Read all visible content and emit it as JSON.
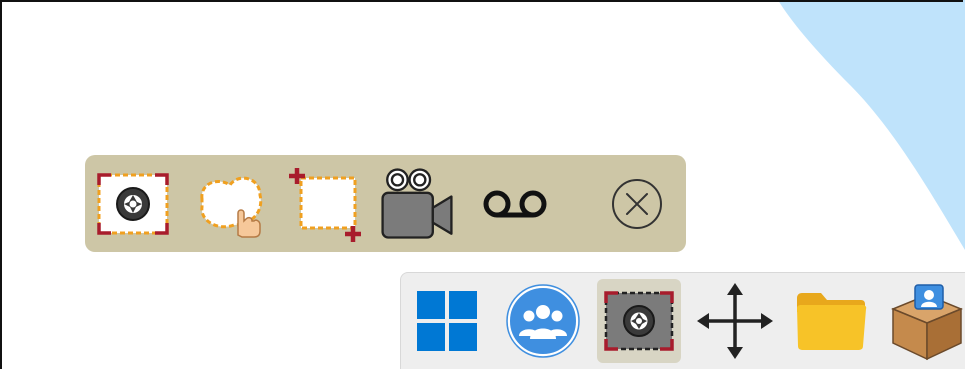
{
  "window": {
    "title": ""
  },
  "colors": {
    "background": "#ffffff",
    "background_shape": "#bfe3fb",
    "toolbar_bg": "#cdc6a6",
    "dashed_orange": "#f0a020",
    "crop_red": "#a81c2c",
    "taskbar_bg": "#eeeeee",
    "windows_blue": "#0078d4",
    "people_blue": "#3f8fe0",
    "folder_yellow": "#f7c328"
  },
  "capture_toolbar": {
    "buttons": [
      {
        "id": "fullscreen-capture",
        "icon": "camera-aperture-icon",
        "label": ""
      },
      {
        "id": "freeform-capture",
        "icon": "freeform-hand-icon",
        "label": ""
      },
      {
        "id": "region-capture",
        "icon": "crop-region-icon",
        "label": ""
      },
      {
        "id": "video-record",
        "icon": "video-camera-icon",
        "label": ""
      },
      {
        "id": "audio-record",
        "icon": "voicemail-icon",
        "label": ""
      },
      {
        "id": "close",
        "icon": "close-circle-icon",
        "label": ""
      }
    ]
  },
  "taskbar": {
    "items": [
      {
        "id": "start",
        "icon": "windows-logo-icon",
        "active": false
      },
      {
        "id": "people",
        "icon": "people-group-icon",
        "active": false
      },
      {
        "id": "screen-capture",
        "icon": "camera-aperture-icon",
        "active": true
      },
      {
        "id": "move",
        "icon": "move-arrows-icon",
        "active": false
      },
      {
        "id": "file-explorer",
        "icon": "folder-icon",
        "active": false
      },
      {
        "id": "package-installer",
        "icon": "package-box-icon",
        "active": false
      }
    ]
  }
}
